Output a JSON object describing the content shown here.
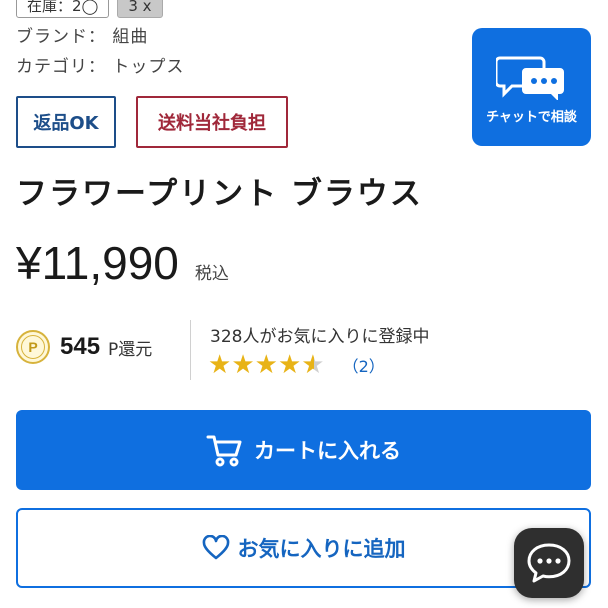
{
  "stock": {
    "chip1": "在庫：2◯",
    "chip2": "3 x"
  },
  "meta": {
    "brand": "ブランド： 組曲",
    "category": "カテゴリ： トップス"
  },
  "badges": {
    "return": "返品OK",
    "shipping": "送料当社負担"
  },
  "chat": {
    "label": "チャットで相談",
    "icon": "chat-bubbles-icon"
  },
  "product": {
    "title": "フラワープリント ブラウス",
    "price": "¥11,990",
    "tax": "税込"
  },
  "points": {
    "symbol": "P",
    "value": "545",
    "unit": "P還元"
  },
  "favorites": {
    "text": "328人がお気に入りに登録中"
  },
  "rating": {
    "stars": 4.5,
    "max": 5,
    "review_count": "（2）"
  },
  "buttons": {
    "cart": "カートに入れる",
    "favorite": "お気に入りに追加"
  },
  "colors": {
    "primary": "#0f6fe0",
    "return_badge": "#1d4e89",
    "shipping_badge": "#a0283a",
    "star": "#e8b317"
  }
}
